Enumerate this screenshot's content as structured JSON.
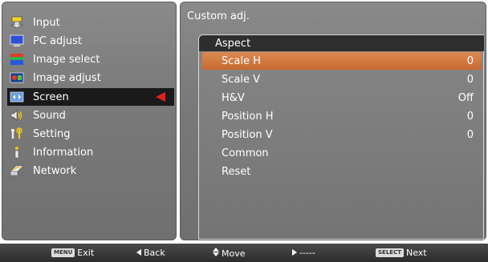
{
  "colors": {
    "panel_gray": "#7a7a7a",
    "selected_left": "#1a1a1a",
    "selected_row": "#d2783c",
    "pointer_red": "#e0201e"
  },
  "menu": {
    "items": [
      {
        "label": "Input",
        "icon": "input-icon"
      },
      {
        "label": "PC adjust",
        "icon": "pc-adjust-icon"
      },
      {
        "label": "Image select",
        "icon": "image-select-icon"
      },
      {
        "label": "Image adjust",
        "icon": "image-adjust-icon"
      },
      {
        "label": "Screen",
        "icon": "screen-icon",
        "selected": true
      },
      {
        "label": "Sound",
        "icon": "sound-icon"
      },
      {
        "label": "Setting",
        "icon": "setting-icon"
      },
      {
        "label": "Information",
        "icon": "information-icon"
      },
      {
        "label": "Network",
        "icon": "network-icon"
      }
    ]
  },
  "panel": {
    "title": "Custom adj.",
    "header": "Aspect",
    "rows": [
      {
        "label": "Scale H",
        "value": "0",
        "selected": true
      },
      {
        "label": "Scale V",
        "value": "0"
      },
      {
        "label": "H&V",
        "value": "Off"
      },
      {
        "label": "Position H",
        "value": "0"
      },
      {
        "label": "Position V",
        "value": "0"
      },
      {
        "label": "Common",
        "value": ""
      },
      {
        "label": "Reset",
        "value": ""
      }
    ]
  },
  "footer": {
    "exit_key": "MENU",
    "exit_label": "Exit",
    "back_label": "Back",
    "move_label": "Move",
    "next_arrow_label": "-----",
    "next_key": "SELECT",
    "next_label": "Next"
  }
}
